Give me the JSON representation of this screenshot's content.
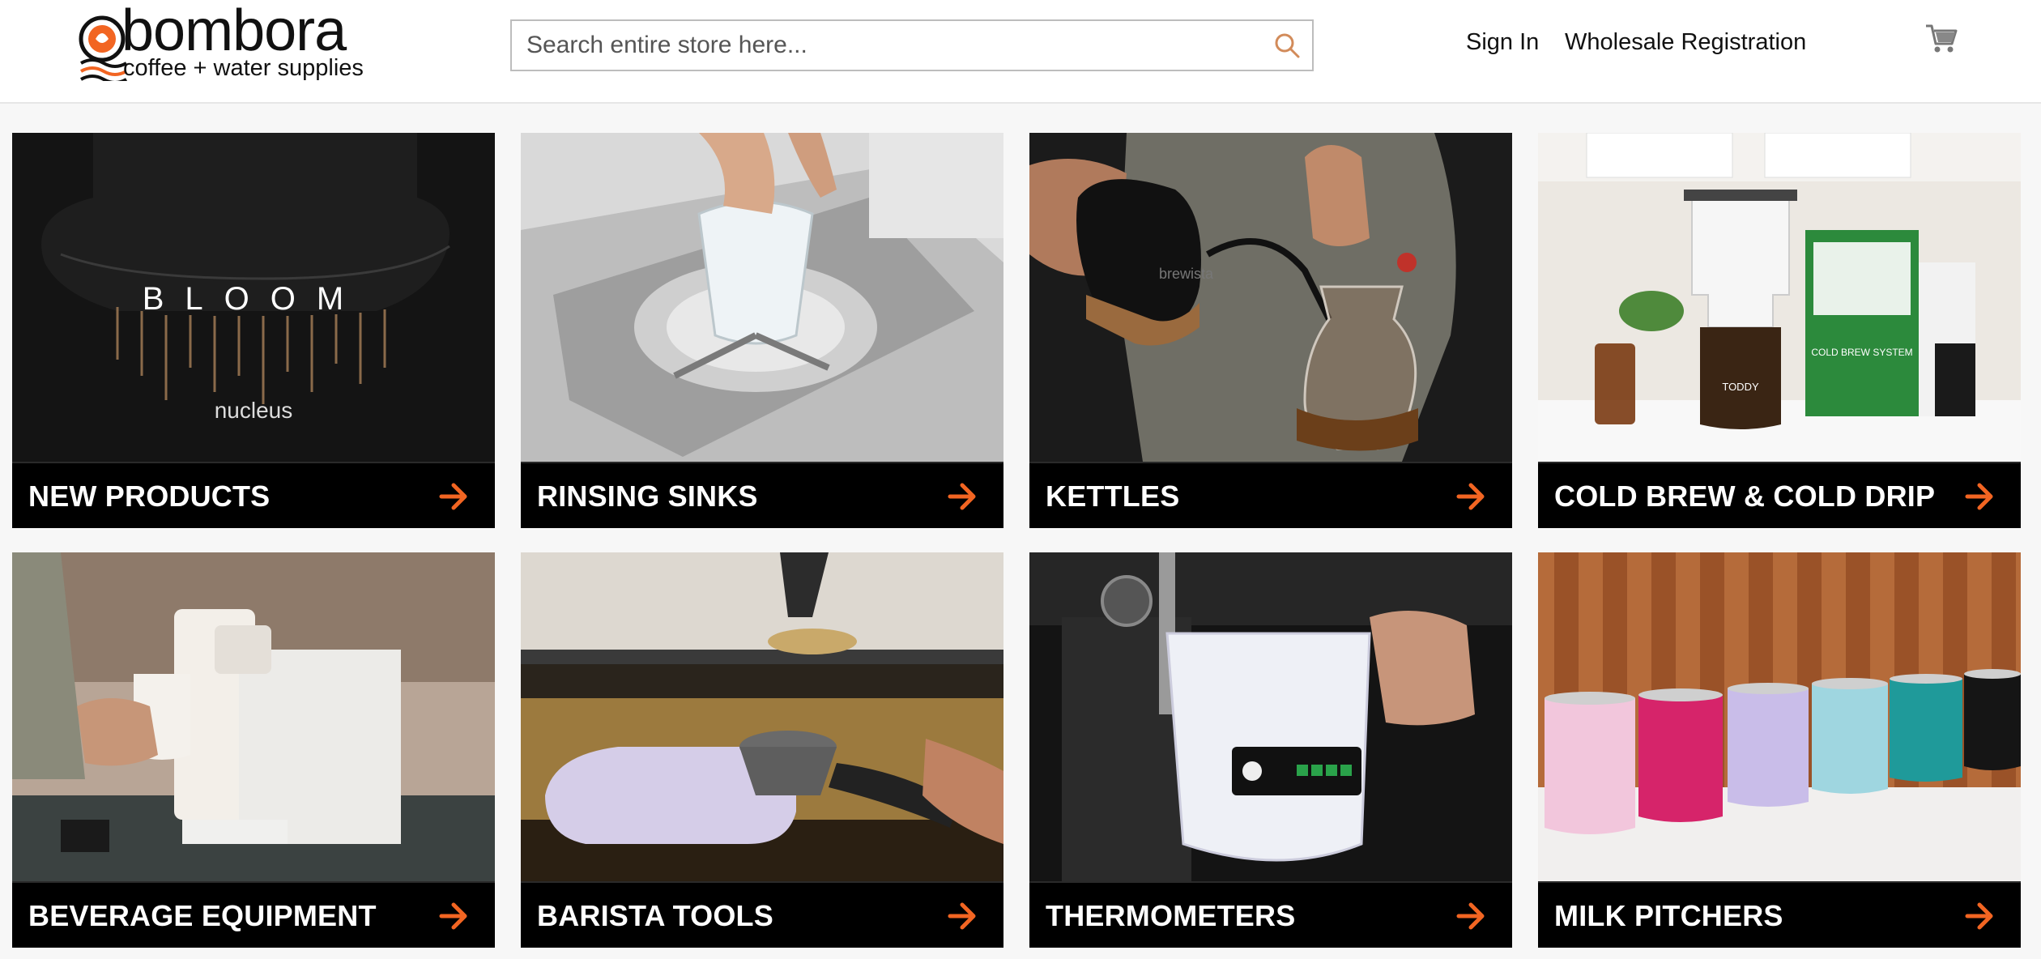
{
  "header": {
    "logo": {
      "word": "bombora",
      "tagline": "coffee + water supplies"
    },
    "search": {
      "placeholder": "Search entire store here...",
      "icon": "search-icon"
    },
    "nav": {
      "sign_in": "Sign In",
      "wholesale": "Wholesale Registration"
    },
    "cart_icon": "cart-icon"
  },
  "colors": {
    "accent": "#f26522",
    "bar": "#000000",
    "header_bg": "#ffffff",
    "page_bg": "#f7f7f7"
  },
  "categories": [
    {
      "label": "NEW PRODUCTS",
      "image": {
        "word": "BLOOM",
        "brand": "nucleus"
      }
    },
    {
      "label": "RINSING SINKS"
    },
    {
      "label": "KETTLES",
      "image": {
        "brand": "brewista"
      }
    },
    {
      "label": "COLD BREW & COLD DRIP",
      "image": {
        "brand": "TODDY",
        "box_text": "COLD BREW SYSTEM"
      }
    },
    {
      "label": "BEVERAGE EQUIPMENT"
    },
    {
      "label": "BARISTA TOOLS"
    },
    {
      "label": "THERMOMETERS"
    },
    {
      "label": "MILK PITCHERS"
    }
  ]
}
